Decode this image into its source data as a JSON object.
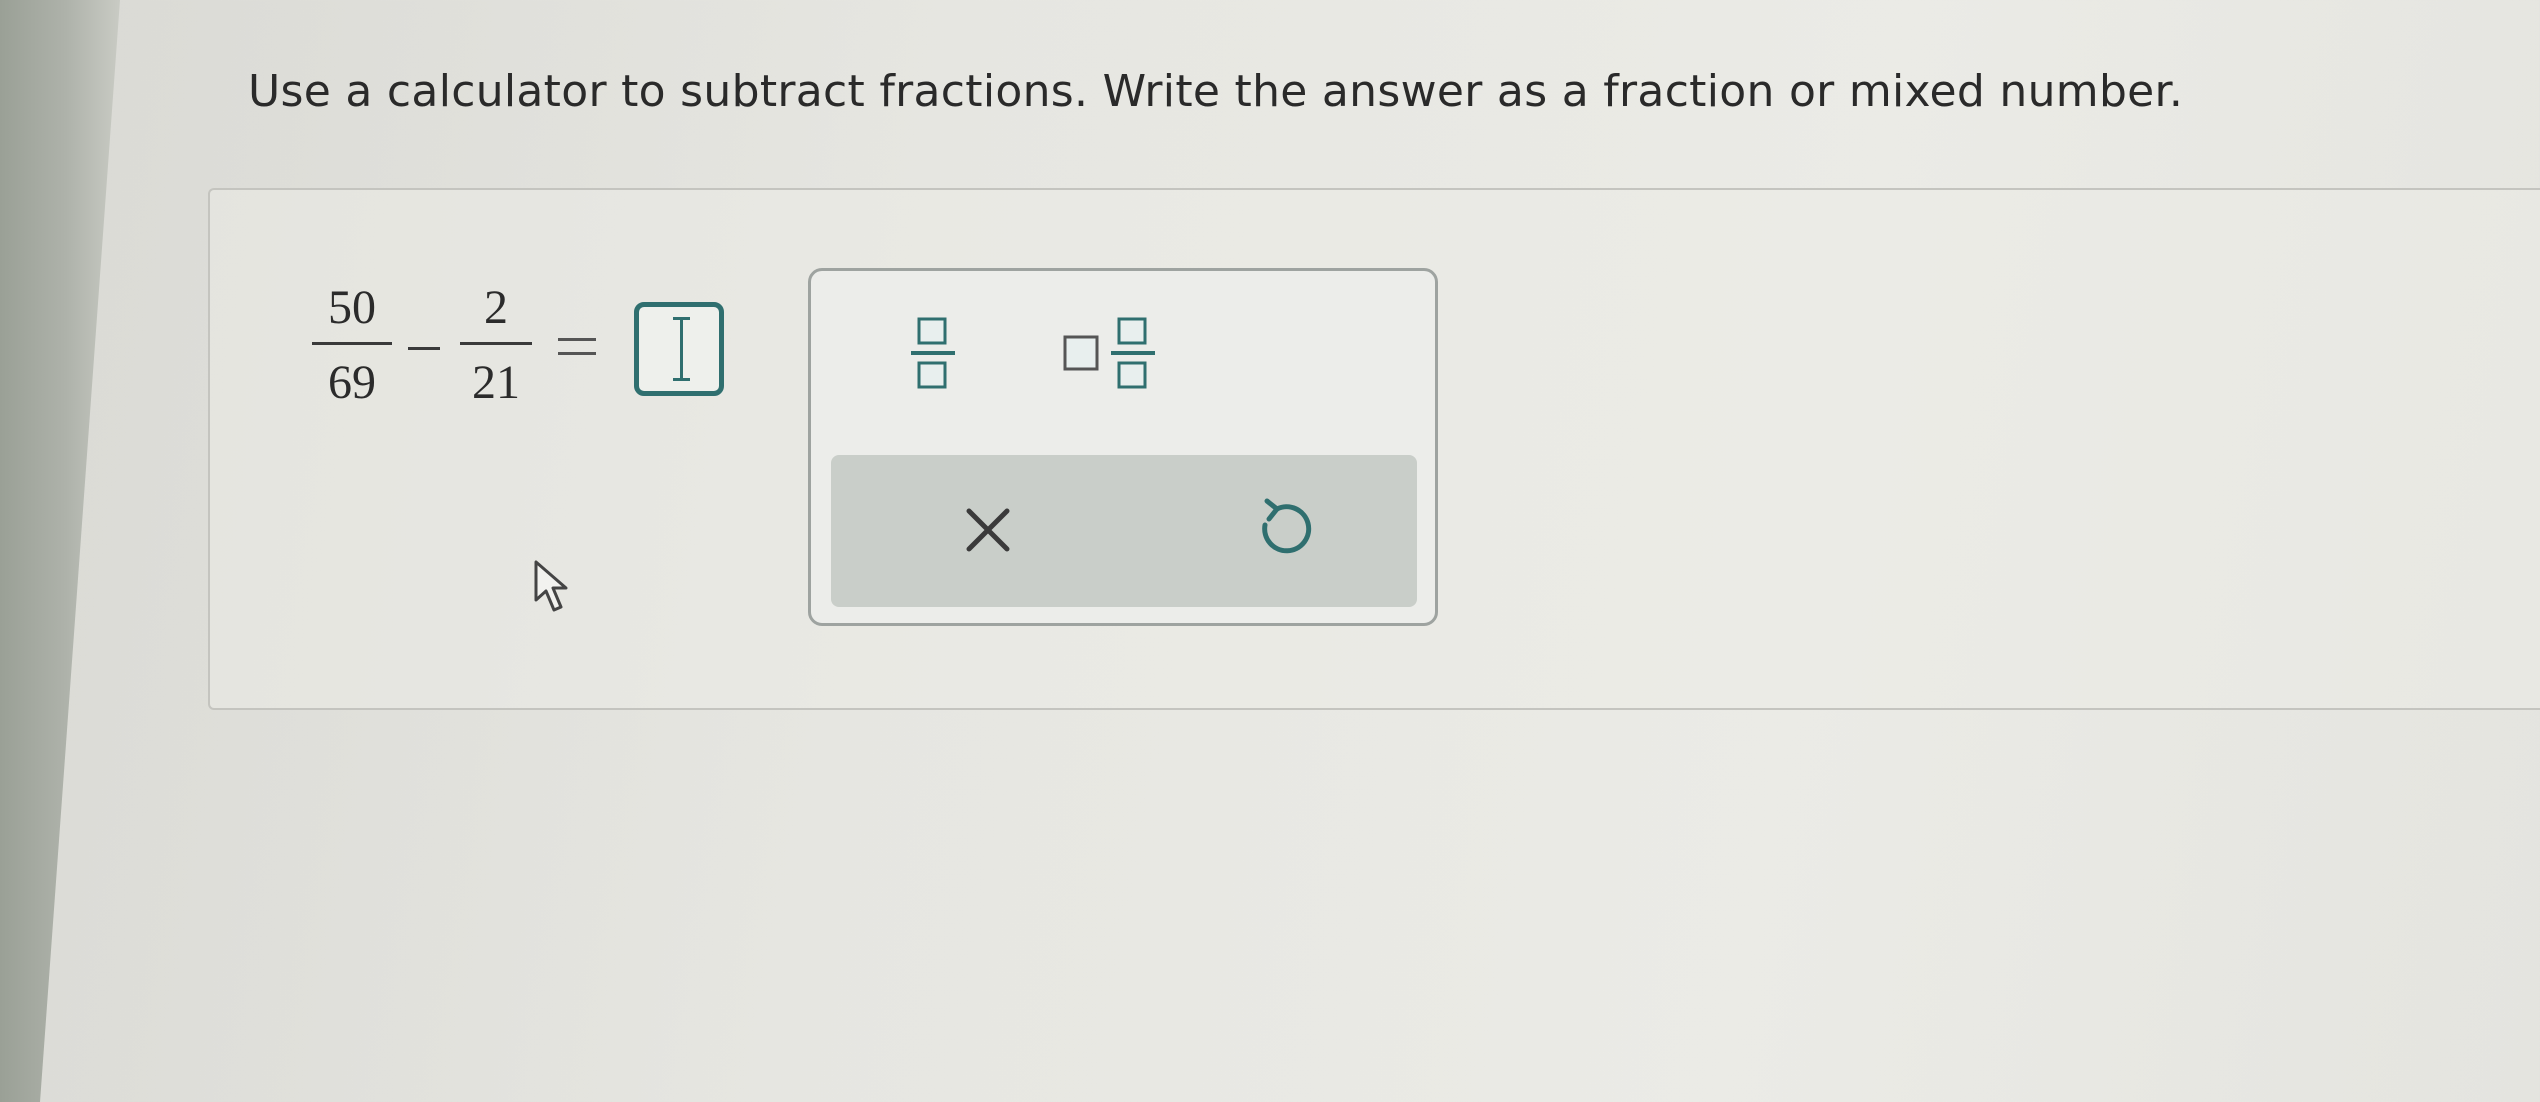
{
  "instruction": "Use a calculator to subtract fractions. Write the answer as a fraction or mixed number.",
  "expression": {
    "fraction1": {
      "numerator": "50",
      "denominator": "69"
    },
    "operator": "minus",
    "fraction2": {
      "numerator": "2",
      "denominator": "21"
    },
    "equals": "equals"
  },
  "answer": {
    "value": "",
    "focused": true
  },
  "toolbox": {
    "tools": [
      {
        "name": "fraction-tool",
        "icon": "fraction-icon"
      },
      {
        "name": "mixed-number-tool",
        "icon": "mixed-number-icon"
      }
    ],
    "actions": [
      {
        "name": "clear",
        "icon": "x-icon"
      },
      {
        "name": "undo",
        "icon": "undo-icon"
      }
    ]
  },
  "colors": {
    "accent": "#2f6f6f",
    "toolbar_bg": "#c9cec9",
    "text": "#2a2a2a"
  }
}
